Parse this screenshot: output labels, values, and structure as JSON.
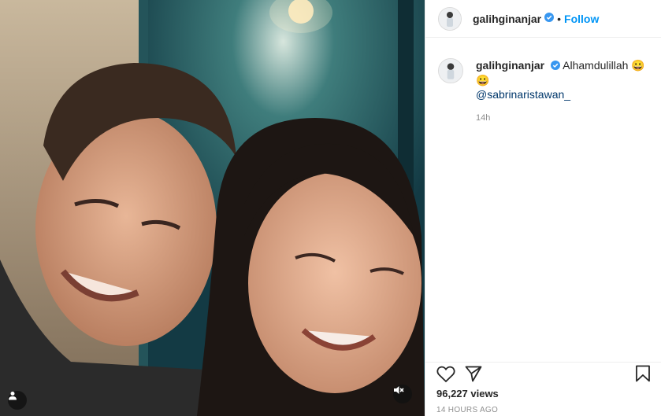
{
  "post": {
    "username": "galihginanjar",
    "follow_label": "Follow",
    "separator": "•"
  },
  "caption": {
    "username": "galihginanjar",
    "text": "Alhamdulillah 😀😀",
    "mention": "@sabrinaristawan_",
    "time": "14h"
  },
  "stats": {
    "views": "96,227 views",
    "posted": "14 HOURS AGO"
  },
  "icons": {
    "verified": "verified-badge-icon",
    "like": "heart-icon",
    "share": "paper-plane-icon",
    "save": "bookmark-icon",
    "mute": "speaker-muted-icon",
    "tags": "user-tag-icon"
  },
  "colors": {
    "accent": "#0095f6",
    "mention": "#00376b",
    "verified": "#3897f0",
    "muted_text": "#8e8e8e"
  }
}
